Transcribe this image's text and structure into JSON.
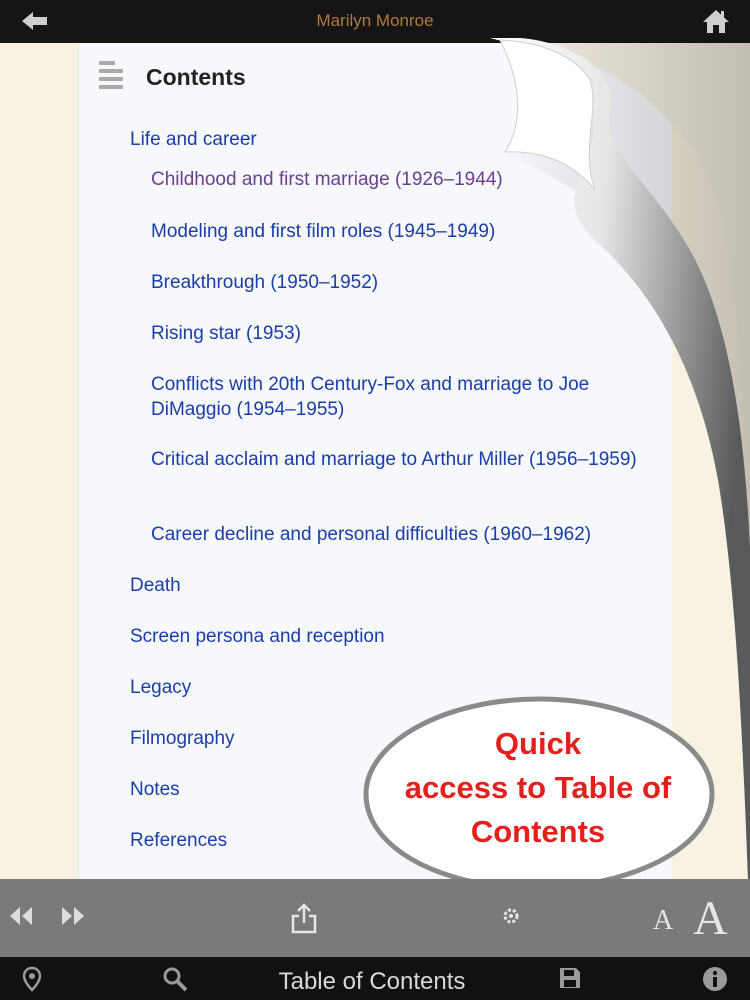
{
  "header": {
    "title": "Marilyn Monroe"
  },
  "toc": {
    "title": "Contents",
    "items": [
      {
        "label": "Life and career",
        "level": 1,
        "visited": false
      },
      {
        "label": "Childhood and first marriage (1926–1944)",
        "level": 2,
        "visited": true
      },
      {
        "label": "Modeling and first film roles (1945–1949)",
        "level": 2,
        "visited": false
      },
      {
        "label": "Breakthrough (1950–1952)",
        "level": 2,
        "visited": false
      },
      {
        "label": "Rising star (1953)",
        "level": 2,
        "visited": false
      },
      {
        "label": "Conflicts with 20th Century-Fox and marriage to Joe DiMaggio (1954–1955)",
        "level": 2,
        "visited": false
      },
      {
        "label": "Critical acclaim and marriage to Arthur Miller (1956–1959)",
        "level": 2,
        "visited": false
      },
      {
        "label": "Career decline and personal difficulties (1960–1962)",
        "level": 2,
        "visited": false
      },
      {
        "label": "Death",
        "level": 1,
        "visited": false
      },
      {
        "label": "Screen persona and reception",
        "level": 1,
        "visited": false
      },
      {
        "label": "Legacy",
        "level": 1,
        "visited": false
      },
      {
        "label": "Filmography",
        "level": 1,
        "visited": false
      },
      {
        "label": "Notes",
        "level": 1,
        "visited": false
      },
      {
        "label": "References",
        "level": 1,
        "visited": false
      }
    ]
  },
  "callout": {
    "lines": [
      "Quick",
      "access to Table of",
      "Contents"
    ]
  },
  "toolbar": {
    "prev_icon": "previous-page-icon",
    "next_icon": "next-page-icon",
    "share_icon": "share-icon",
    "settings_icon": "gear-icon",
    "font_small_label": "A",
    "font_large_label": "A"
  },
  "bottombar": {
    "title": "Table of Contents"
  },
  "colors": {
    "link": "#1a3ea8",
    "visited_link": "#6b3f8e",
    "callout_text": "#e3201b",
    "title_text": "#b07a3a"
  }
}
